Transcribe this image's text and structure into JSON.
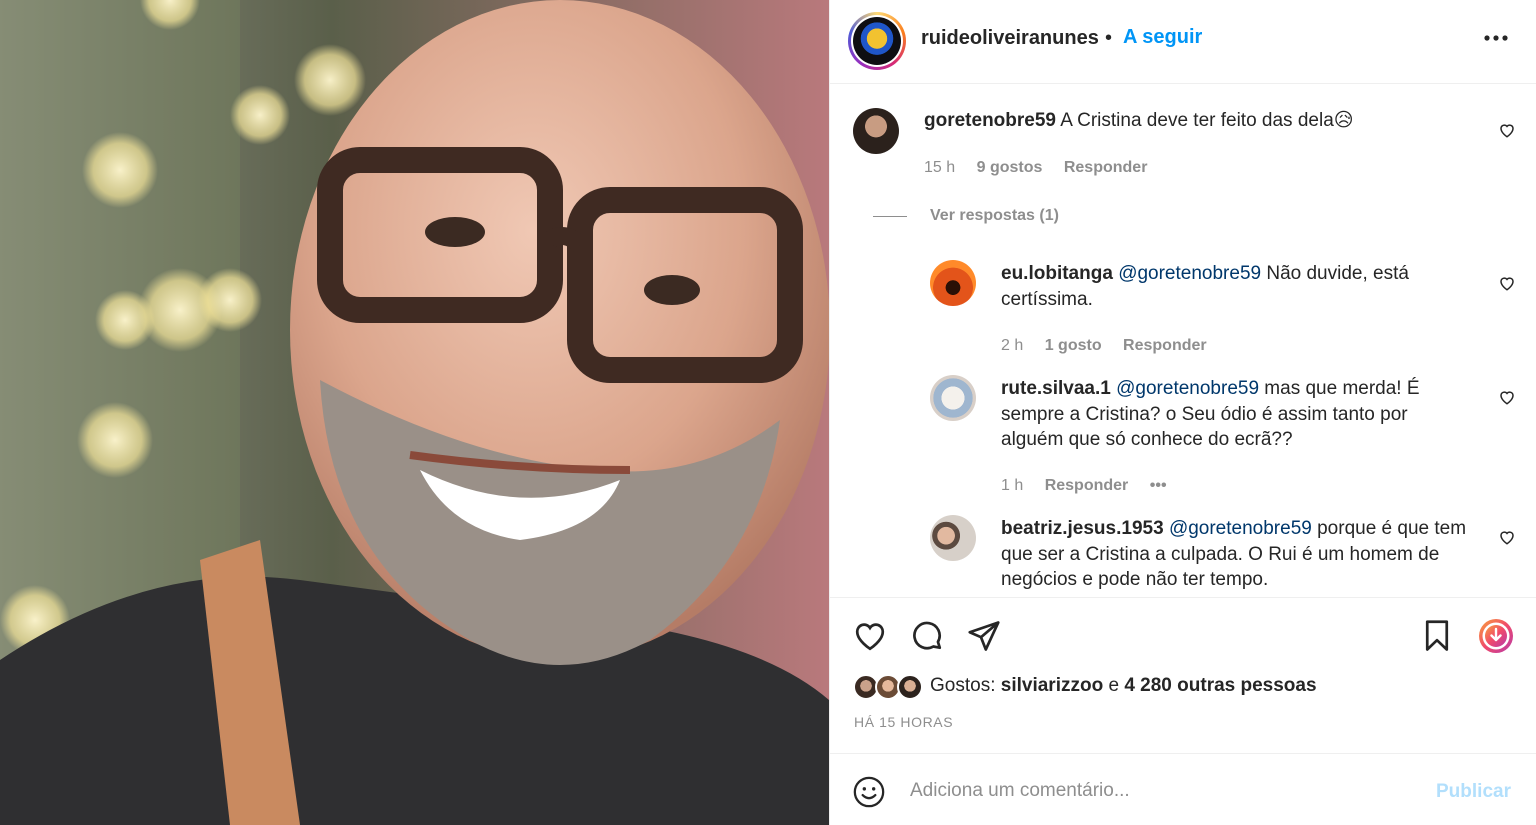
{
  "post": {
    "author": "ruideoliveiranunes",
    "separator": "•",
    "follow_label": "A seguir"
  },
  "comments": [
    {
      "username": "goretenobre59",
      "text": "A Cristina deve ter feito das dela😥",
      "time": "15 h",
      "likes": "9 gostos",
      "reply_label": "Responder",
      "view_replies": "Ver respostas (1)"
    },
    {
      "username": "eu.lobitanga",
      "mention": "@goretenobre59",
      "text": "Não duvide, está certíssima.",
      "time": "2 h",
      "likes": "1 gosto",
      "reply_label": "Responder"
    },
    {
      "username": "rute.silvaa.1",
      "mention": "@goretenobre59",
      "text": "mas que merda! É sempre a Cristina? o Seu ódio é assim tanto por alguém que só conhece do ecrã??",
      "time": "1 h",
      "reply_label": "Responder",
      "more": "•••"
    },
    {
      "username": "beatriz.jesus.1953",
      "mention": "@goretenobre59",
      "text": "porque é que tem que ser a Cristina a culpada. O Rui é um homem de negócios e pode não ter tempo."
    }
  ],
  "likes": {
    "prefix": "Gostos:",
    "user": "silviarizzoo",
    "joiner": "e",
    "others": "4 280 outras pessoas"
  },
  "timestamp": "HÁ 15 HORAS",
  "composer": {
    "placeholder": "Adiciona um comentário...",
    "publish_label": "Publicar"
  },
  "icons": {
    "more": "more-horizontal-icon",
    "like": "heart-icon",
    "comment": "comment-icon",
    "share": "paper-plane-icon",
    "save": "bookmark-icon",
    "download": "download-circle-icon",
    "emoji": "emoji-icon"
  },
  "colors": {
    "link_blue": "#0095f6",
    "mention_blue": "#00376b",
    "muted": "#8e8e8e",
    "publish_disabled": "#b2dffc"
  }
}
